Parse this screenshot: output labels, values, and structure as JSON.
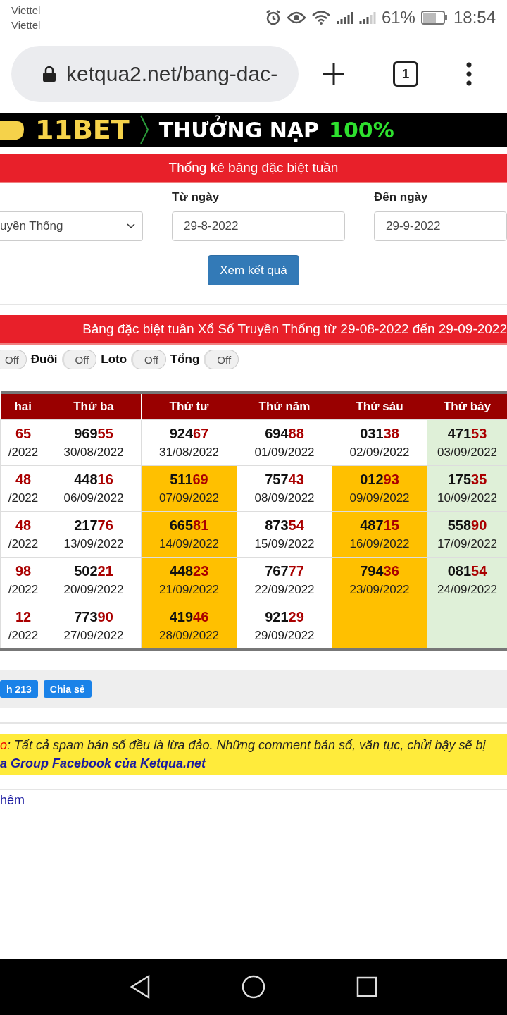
{
  "status_bar": {
    "carriers": [
      "Viettel",
      "Viettel"
    ],
    "battery": "61%",
    "time": "18:54"
  },
  "browser": {
    "url": "ketqua2.net/bang-dac-",
    "tab_count": "1"
  },
  "ad_banner": {
    "brand": "11BET",
    "headline": "THƯỞNG NẠP",
    "highlight": "100%"
  },
  "form": {
    "title": "Thống kê bảng đặc biệt tuần",
    "type_value": "uyền Thống",
    "from_label": "Từ ngày",
    "from_value": "29-8-2022",
    "to_label": "Đến ngày",
    "to_value": "29-9-2022",
    "submit": "Xem kết quả"
  },
  "result_title": "Bảng đặc biệt tuần Xổ Số Truyền Thống từ 29-08-2022 đến 29-09-2022",
  "filters": [
    {
      "kind": "switch",
      "text": "Off",
      "on": false
    },
    {
      "kind": "label",
      "text": "Đuôi"
    },
    {
      "kind": "switch",
      "text": "Off",
      "on": false
    },
    {
      "kind": "label",
      "text": "Loto"
    },
    {
      "kind": "switch",
      "text": "Off",
      "on": false
    },
    {
      "kind": "label",
      "text": "Tổng"
    },
    {
      "kind": "switch",
      "text": "Off",
      "on": false
    }
  ],
  "table": {
    "columns": [
      {
        "label": "hai",
        "weekend": false
      },
      {
        "label": "Thứ ba",
        "weekend": false
      },
      {
        "label": "Thứ tư",
        "weekend": false
      },
      {
        "label": "Thứ năm",
        "weekend": false
      },
      {
        "label": "Thứ sáu",
        "weekend": false
      },
      {
        "label": "Thứ bảy",
        "weekend": true
      }
    ],
    "rows": [
      [
        {
          "number": "65",
          "date": "/2022",
          "highlighted": false
        },
        {
          "number": "96955",
          "date": "30/08/2022",
          "highlighted": false
        },
        {
          "number": "92467",
          "date": "31/08/2022",
          "highlighted": false
        },
        {
          "number": "69488",
          "date": "01/09/2022",
          "highlighted": false
        },
        {
          "number": "03138",
          "date": "02/09/2022",
          "highlighted": false
        },
        {
          "number": "47153",
          "date": "03/09/2022",
          "highlighted": false
        }
      ],
      [
        {
          "number": "48",
          "date": "/2022",
          "highlighted": false
        },
        {
          "number": "44816",
          "date": "06/09/2022",
          "highlighted": false
        },
        {
          "number": "51169",
          "date": "07/09/2022",
          "highlighted": true
        },
        {
          "number": "75743",
          "date": "08/09/2022",
          "highlighted": false
        },
        {
          "number": "01293",
          "date": "09/09/2022",
          "highlighted": true
        },
        {
          "number": "17535",
          "date": "10/09/2022",
          "highlighted": false
        }
      ],
      [
        {
          "number": "48",
          "date": "/2022",
          "highlighted": false
        },
        {
          "number": "21776",
          "date": "13/09/2022",
          "highlighted": false
        },
        {
          "number": "66581",
          "date": "14/09/2022",
          "highlighted": true
        },
        {
          "number": "87354",
          "date": "15/09/2022",
          "highlighted": false
        },
        {
          "number": "48715",
          "date": "16/09/2022",
          "highlighted": true
        },
        {
          "number": "55890",
          "date": "17/09/2022",
          "highlighted": false
        }
      ],
      [
        {
          "number": "98",
          "date": "/2022",
          "highlighted": false
        },
        {
          "number": "50221",
          "date": "20/09/2022",
          "highlighted": false
        },
        {
          "number": "44823",
          "date": "21/09/2022",
          "highlighted": true
        },
        {
          "number": "76777",
          "date": "22/09/2022",
          "highlighted": false
        },
        {
          "number": "79436",
          "date": "23/09/2022",
          "highlighted": true
        },
        {
          "number": "08154",
          "date": "24/09/2022",
          "highlighted": false
        }
      ],
      [
        {
          "number": "12",
          "date": "/2022",
          "highlighted": false
        },
        {
          "number": "77390",
          "date": "27/09/2022",
          "highlighted": false
        },
        {
          "number": "41946",
          "date": "28/09/2022",
          "highlighted": true
        },
        {
          "number": "92129",
          "date": "29/09/2022",
          "highlighted": false
        },
        {
          "highlighted": true
        },
        {
          "highlighted": false
        }
      ]
    ]
  },
  "share_buttons": [
    "h 213",
    "Chia sẻ"
  ],
  "notice": {
    "lead": "o",
    "text": ": Tất cả spam bán số đều là lừa đảo. Những comment bán số, văn tục, chửi bậy sẽ bị",
    "link": "a Group Facebook của Ketqua.net"
  },
  "more_link": "hêm"
}
